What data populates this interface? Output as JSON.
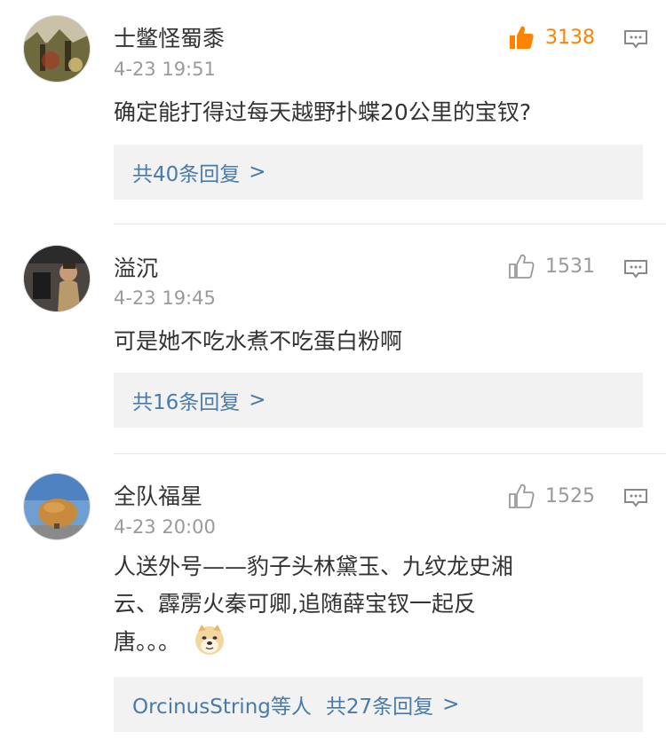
{
  "comments": [
    {
      "username": "士鳖怪蜀黍",
      "time": "4-23 19:51",
      "likes": "3138",
      "liked": true,
      "content_lines": [
        "确定能打得过每天越野扑蝶20公里的宝钗?"
      ],
      "emoji": null,
      "replies_prefix": "",
      "replies_label": "共40条回复",
      "replies_arrow": ">"
    },
    {
      "username": "溢沉",
      "time": "4-23 19:45",
      "likes": "1531",
      "liked": false,
      "content_lines": [
        "可是她不吃水煮不吃蛋白粉啊"
      ],
      "emoji": null,
      "replies_prefix": "",
      "replies_label": "共16条回复",
      "replies_arrow": ">"
    },
    {
      "username": "全队福星",
      "time": "4-23 20:00",
      "likes": "1525",
      "liked": false,
      "content_lines": [
        "人送外号——豹子头林黛玉、九纹龙史湘",
        "云、霹雳火秦可卿,追随薛宝钗一起反",
        "唐。。。"
      ],
      "emoji": "doge-emoji",
      "replies_prefix": "OrcinusString等人",
      "replies_label": "共27条回复",
      "replies_arrow": ">"
    }
  ],
  "colors": {
    "liked": "#ff8200",
    "link": "#4a7ba8",
    "muted": "#9a9a9a",
    "reply_bg": "#f2f2f2"
  },
  "icons": [
    "thumbs-up-icon",
    "comment-reply-icon",
    "doge-emoji"
  ]
}
